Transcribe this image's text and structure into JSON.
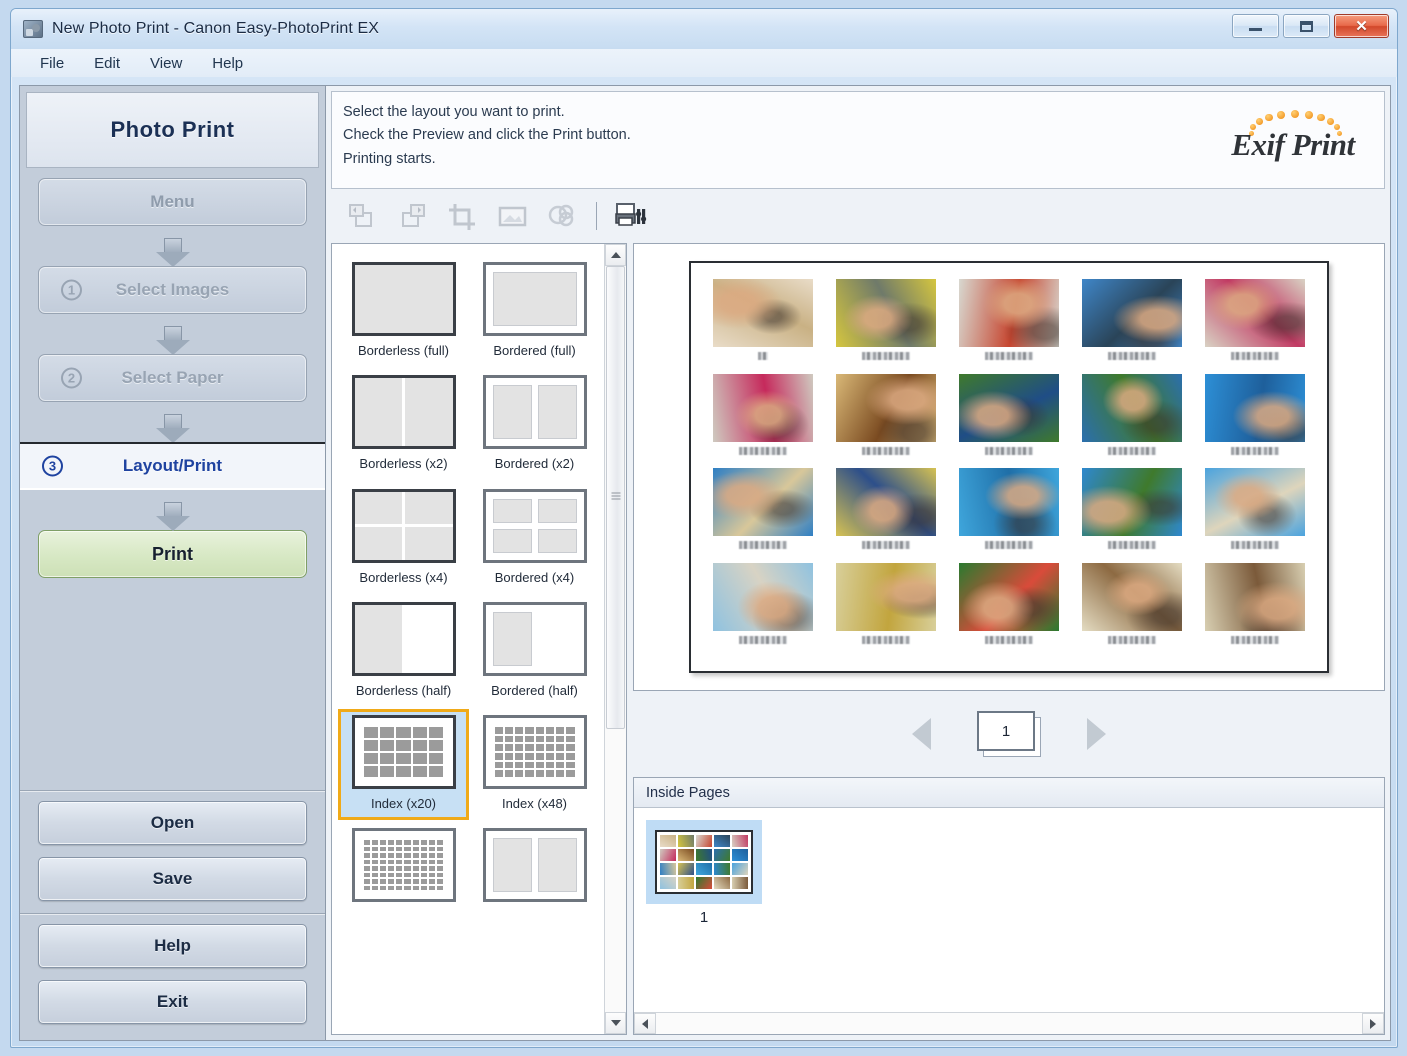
{
  "window": {
    "title": "New Photo Print - Canon Easy-PhotoPrint EX",
    "minimize_label": "–",
    "maximize_label": "□",
    "close_label": "✕"
  },
  "menubar": {
    "items": [
      "File",
      "Edit",
      "View",
      "Help"
    ]
  },
  "sidebar": {
    "header": "Photo Print",
    "steps": [
      {
        "num": "",
        "label": "Menu",
        "state": "enabled"
      },
      {
        "num": "①",
        "label": "Select Images",
        "state": "disabled"
      },
      {
        "num": "②",
        "label": "Select Paper",
        "state": "disabled"
      },
      {
        "num": "③",
        "label": "Layout/Print",
        "state": "active"
      }
    ],
    "print_button": "Print",
    "buttons_top": [
      "Open",
      "Save"
    ],
    "buttons_bottom": [
      "Help",
      "Exit"
    ]
  },
  "instructions": {
    "line1": "Select the layout you want to print.",
    "line2": "Check the Preview and click the Print button.",
    "line3": "Printing starts."
  },
  "logo": {
    "text": "Exif Print"
  },
  "toolbar": {
    "items": [
      {
        "name": "rotate-left-icon",
        "enabled": false
      },
      {
        "name": "rotate-right-icon",
        "enabled": false
      },
      {
        "name": "crop-icon",
        "enabled": false
      },
      {
        "name": "image-correct-icon",
        "enabled": false
      },
      {
        "name": "color-adjust-icon",
        "enabled": false
      },
      {
        "name": "print-settings-icon",
        "enabled": true
      }
    ]
  },
  "layouts": {
    "items": [
      {
        "label": "Borderless\n(full)",
        "kind": "borderless",
        "cells": 1,
        "selected": false
      },
      {
        "label": "Bordered (full)",
        "kind": "bordered",
        "cells": 1,
        "selected": false
      },
      {
        "label": "Borderless\n(x2)",
        "kind": "borderless",
        "cells": 2,
        "selected": false
      },
      {
        "label": "Bordered (x2)",
        "kind": "bordered",
        "cells": 2,
        "selected": false
      },
      {
        "label": "Borderless\n(x4)",
        "kind": "borderless",
        "cells": 4,
        "selected": false
      },
      {
        "label": "Bordered (x4)",
        "kind": "bordered",
        "cells": 4,
        "selected": false
      },
      {
        "label": "Borderless\n(half)",
        "kind": "borderless",
        "cells": 0.5,
        "selected": false
      },
      {
        "label": "Bordered\n(half)",
        "kind": "bordered",
        "cells": 0.5,
        "selected": false
      },
      {
        "label": "Index (x20)",
        "kind": "index",
        "cells": 20,
        "selected": true
      },
      {
        "label": "Index (x48)",
        "kind": "index",
        "cells": 48,
        "selected": false
      },
      {
        "label": "",
        "kind": "index",
        "cells": 80,
        "selected": false
      },
      {
        "label": "",
        "kind": "bordered",
        "cells": 2,
        "selected": false
      }
    ]
  },
  "preview": {
    "photo_count": 20,
    "caption_visible": true,
    "colors": [
      [
        "#e9dcc8",
        "#c9b184"
      ],
      [
        "#d5c63f",
        "#6f7a6a"
      ],
      [
        "#d8d8d0",
        "#c6452f"
      ],
      [
        "#3f86c8",
        "#2a4458"
      ],
      [
        "#d9d2c4",
        "#c13a63"
      ],
      [
        "#cfcac0",
        "#c62a5c"
      ],
      [
        "#d9b877",
        "#7a4a20"
      ],
      [
        "#3f7a2c",
        "#1f4d86"
      ],
      [
        "#2b6fae",
        "#3f7a2c"
      ],
      [
        "#2d8fd6",
        "#1e5f9b"
      ],
      [
        "#2f7fc4",
        "#d8c79a"
      ],
      [
        "#d6c253",
        "#2d4f8a"
      ],
      [
        "#3fa6dc",
        "#1f6fa8"
      ],
      [
        "#2e88cf",
        "#3f7a2c"
      ],
      [
        "#4ba3de",
        "#ded5bc"
      ],
      [
        "#8fc2e0",
        "#d8d3c4"
      ],
      [
        "#d8cf9a",
        "#c2a53e"
      ],
      [
        "#2a7a2f",
        "#d94b3a"
      ],
      [
        "#e4dcc2",
        "#8d6a42"
      ],
      [
        "#d8cfb2",
        "#7b5a3a"
      ]
    ]
  },
  "pagenav": {
    "current_page": "1",
    "prev_enabled": false,
    "next_enabled": false
  },
  "pages_panel": {
    "title": "Inside Pages",
    "pages": [
      {
        "number": "1",
        "selected": true
      }
    ]
  }
}
